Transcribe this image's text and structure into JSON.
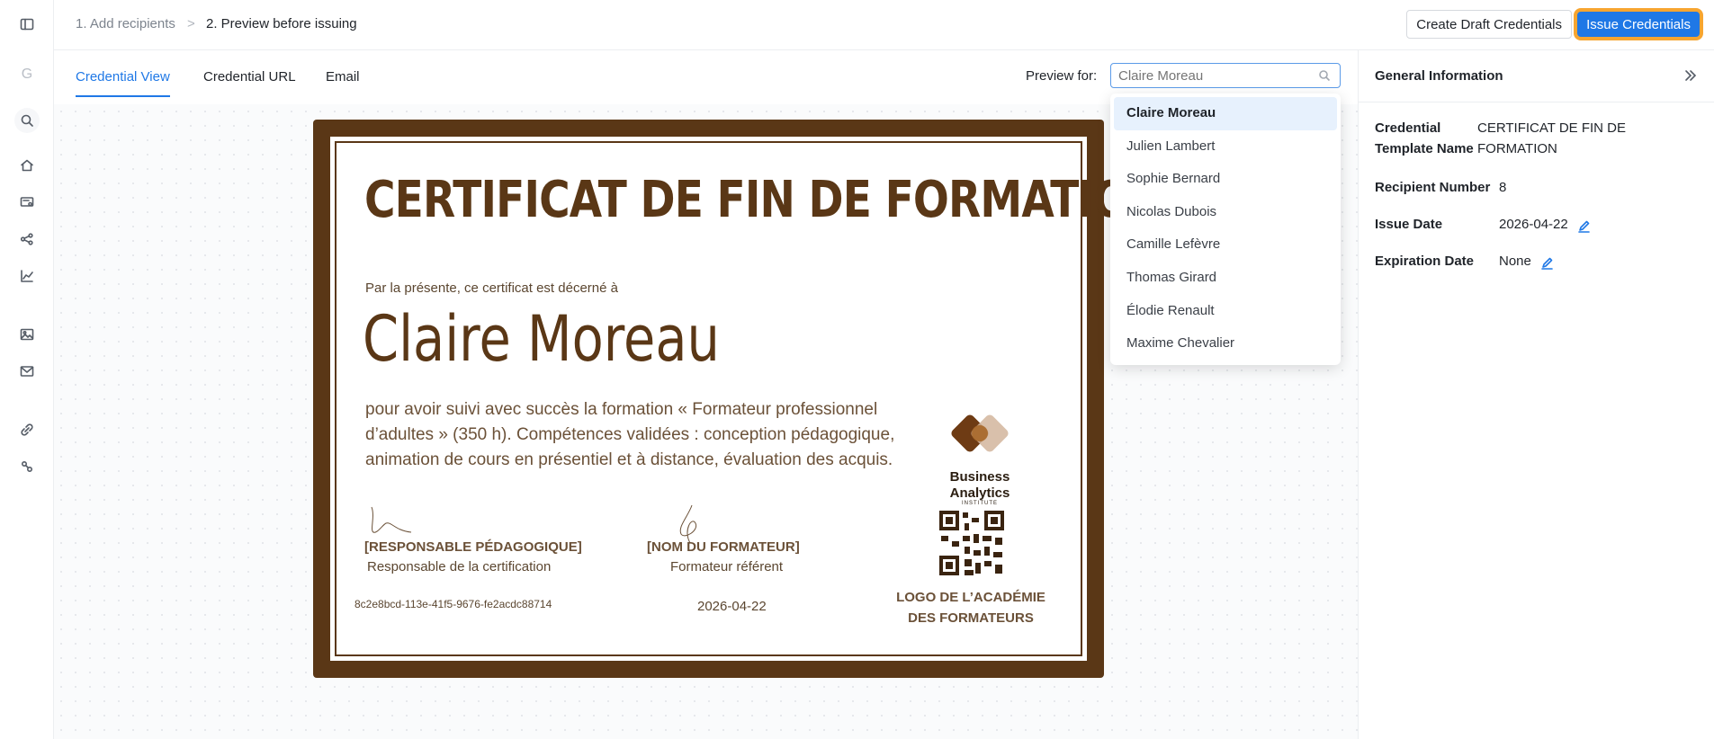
{
  "rail": {
    "letter": "G",
    "items": [
      "sidebar-toggle-icon",
      "search-icon",
      "home-icon",
      "credentials-icon",
      "workflow-icon",
      "analytics-icon",
      "image-icon",
      "mail-icon",
      "integrations-icon",
      "settings-icon"
    ]
  },
  "header": {
    "step1": "1. Add recipients",
    "separator": ">",
    "step2": "2. Preview before issuing",
    "draft_label": "Create Draft Credentials",
    "issue_label": "Issue Credentials"
  },
  "tabs": {
    "view": "Credential View",
    "url": "Credential URL",
    "email": "Email",
    "active": "Credential View"
  },
  "preview": {
    "label": "Preview for:",
    "placeholder": "Claire Moreau"
  },
  "dropdown": {
    "selected": "Claire Moreau",
    "options": [
      "Claire Moreau",
      "Julien Lambert",
      "Sophie Bernard",
      "Nicolas Dubois",
      "Camille Lefèvre",
      "Thomas Girard",
      "Élodie Renault",
      "Maxime Chevalier"
    ]
  },
  "certificate": {
    "title": "CERTIFICAT DE FIN DE FORMATION",
    "intro": "Par la présente, ce certificat est décerné à",
    "recipient": "Claire Moreau",
    "body": "pour avoir suivi avec succès la formation « Formateur professionnel d’adultes » (350 h). Compétences validées : conception pédagogique, animation de cours en présentiel et à distance, évaluation des acquis.",
    "logo_name_1": "Business",
    "logo_name_2": "Analytics",
    "logo_sub": "INSTITUTE",
    "sig1_role": "[RESPONSABLE PÉDAGOGIQUE]",
    "sig1_sub": "Responsable de la certification",
    "sig2_role": "[NOM DU FORMATEUR]",
    "sig2_sub": "Formateur référent",
    "credential_id": "8c2e8bcd-113e-41f5-9676-fe2acdc88714",
    "date": "2026-04-22",
    "academy_logo_1": "LOGO DE L’ACADÉMIE",
    "academy_logo_2": "DES FORMATEURS",
    "colors": {
      "frame": "#5a3716",
      "text": "#6b5138"
    }
  },
  "panel": {
    "title": "General Information",
    "template_label": "Credential Template Name",
    "template_value": "CERTIFICAT DE FIN DE FORMATION",
    "recipients_label": "Recipient Number",
    "recipients_value": "8",
    "issue_label": "Issue Date",
    "issue_value": "2026-04-22",
    "expiration_label": "Expiration Date",
    "expiration_value": "None"
  },
  "colors": {
    "accent": "#1f78e6",
    "highlight": "#f7a530"
  }
}
